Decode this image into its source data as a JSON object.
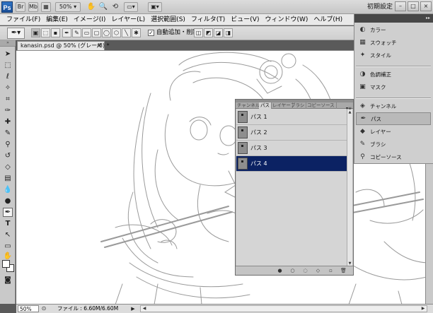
{
  "app": {
    "logo": "Ps",
    "zoom_label": "50%",
    "workspace_label": "初期設定",
    "window_buttons": [
      "–",
      "□",
      "×"
    ]
  },
  "menu": {
    "items": [
      "ファイル(F)",
      "編集(E)",
      "イメージ(I)",
      "レイヤー(L)",
      "選択範囲(S)",
      "フィルタ(T)",
      "ビュー(V)",
      "ウィンドウ(W)",
      "ヘルプ(H)"
    ]
  },
  "options": {
    "auto_add_delete_label": "自動追加・削除",
    "auto_add_delete_checked": true
  },
  "document": {
    "tab_title": "kanasin.psd @ 50% (グレー/8) *",
    "close_glyph": "×"
  },
  "status": {
    "zoom": "50%",
    "file_info": "ファイル : 6.60M/6.60M"
  },
  "paths_panel": {
    "tabs": [
      "チャンネル",
      "パス",
      "レイヤー",
      "ブラシ",
      "コピーソース"
    ],
    "active_tab": "パス",
    "menu_glyph": "▾≡",
    "paths": [
      {
        "name": "パス 1",
        "selected": false
      },
      {
        "name": "パス 2",
        "selected": false
      },
      {
        "name": "パス 3",
        "selected": false
      },
      {
        "name": "パス 4",
        "selected": true
      }
    ]
  },
  "dock": {
    "items": [
      {
        "label": "カラー",
        "icon": "color-palette-icon"
      },
      {
        "label": "スウォッチ",
        "icon": "swatches-icon"
      },
      {
        "label": "スタイル",
        "icon": "styles-icon"
      },
      {
        "label": "色調補正",
        "icon": "adjustments-icon"
      },
      {
        "label": "マスク",
        "icon": "masks-icon"
      },
      {
        "label": "チャンネル",
        "icon": "channels-icon"
      },
      {
        "label": "パス",
        "icon": "paths-icon",
        "active": true
      },
      {
        "label": "レイヤー",
        "icon": "layers-icon"
      },
      {
        "label": "ブラシ",
        "icon": "brush-icon"
      },
      {
        "label": "コピーソース",
        "icon": "clone-source-icon"
      }
    ]
  },
  "colors": {
    "selection_highlight": "#0b2263",
    "canvas": "#ffffff",
    "ui_gray": "#cfcfcf"
  }
}
